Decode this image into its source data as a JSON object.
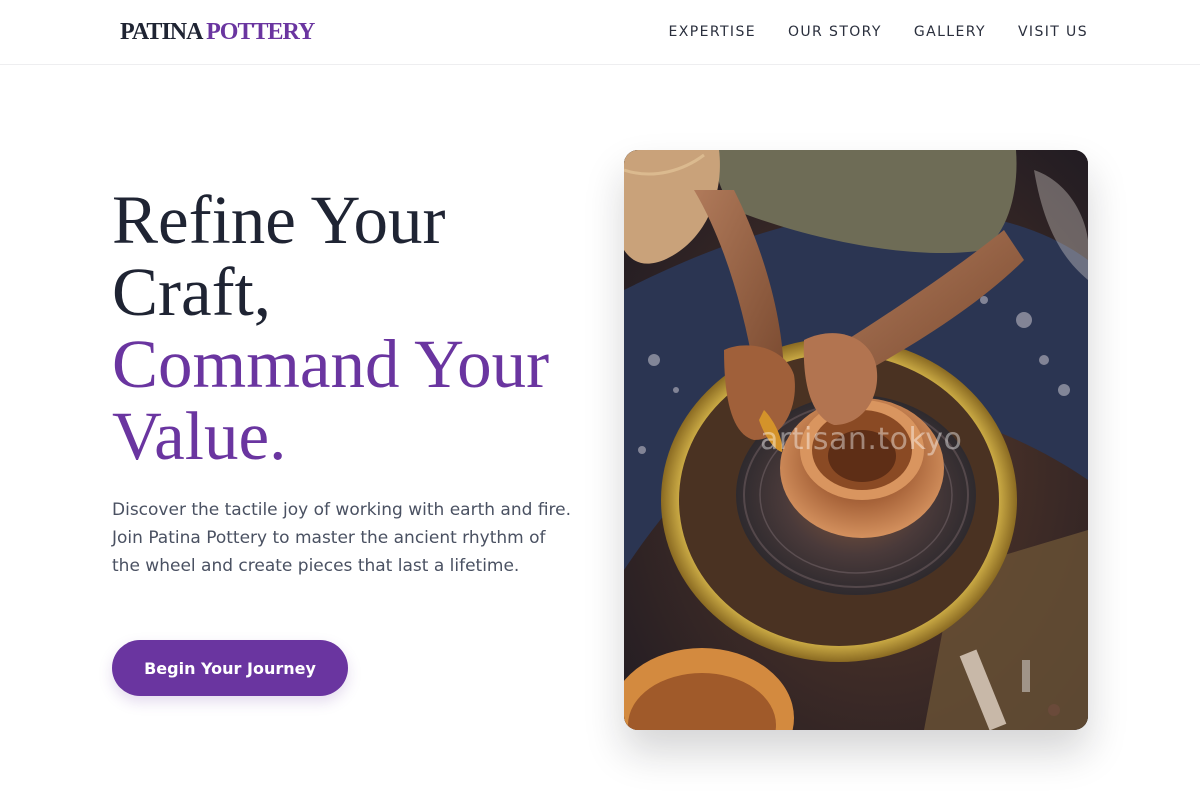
{
  "brand": {
    "name_part1": "PATINA",
    "name_part2": "POTTERY",
    "accent_color": "#6a35a0",
    "dark_color": "#1f2433"
  },
  "nav": {
    "items": [
      {
        "label": "EXPERTISE"
      },
      {
        "label": "OUR STORY"
      },
      {
        "label": "GALLERY"
      },
      {
        "label": "VISIT US"
      }
    ]
  },
  "hero": {
    "headline_line1": "Refine Your",
    "headline_line2": "Craft,",
    "headline_accent_line1": "Command Your",
    "headline_accent_line2": "Value.",
    "description": "Discover the tactile joy of working with earth and fire. Join Patina Pottery to master the ancient rhythm of the wheel and create pieces that last a lifetime.",
    "cta_label": "Begin Your Journey",
    "image": {
      "subject": "potter shaping a clay bowl on a pottery wheel",
      "watermark": "artisan.tokyo"
    }
  }
}
